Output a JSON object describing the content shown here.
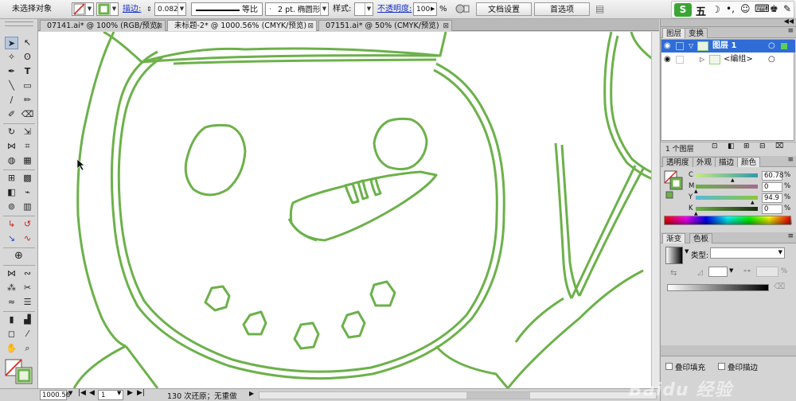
{
  "control_bar": {
    "selection_status": "未选择对象",
    "stroke_label": "描边:",
    "stroke_width": "0.082",
    "profile_label": "等比",
    "brush_label": "2 pt. 椭圆形",
    "style_label": "样式:",
    "opacity_label": "不透明度:",
    "opacity_value": "100",
    "opacity_unit": "%",
    "document_setup_button": "文档设置",
    "preferences_button": "首选项",
    "fill_color": "#ffffff",
    "stroke_color": "#6cb14a"
  },
  "ime_toolbar": {
    "logo": "S",
    "mode": "五"
  },
  "document_tabs": [
    {
      "label": "07141.ai* @ 100% (RGB/预览)",
      "close": "⊠"
    },
    {
      "label": "未标题-2* @ 1000.56% (CMYK/预览)",
      "close": "⊠"
    },
    {
      "label": "07151.ai* @ 50% (CMYK/预览)",
      "close": "⊠"
    }
  ],
  "status_bar": {
    "zoom": "1000.56",
    "page": "1",
    "history": "130 次还原；无重做"
  },
  "layers_panel": {
    "tabs": [
      "图层",
      "变换"
    ],
    "layer_name": "图层 1",
    "group_name": "<编组>",
    "layer_count": "1 个图层"
  },
  "color_panel": {
    "tabs": [
      "透明度",
      "外观",
      "描边",
      "颜色"
    ],
    "channels": [
      {
        "label": "C",
        "value": "60.78"
      },
      {
        "label": "M",
        "value": "0"
      },
      {
        "label": "Y",
        "value": "94.9"
      },
      {
        "label": "K",
        "value": "0"
      }
    ],
    "unit": "%",
    "stroke_swatch_color": "#6cb14a"
  },
  "gradient_panel": {
    "tabs": [
      "渐变",
      "色板"
    ],
    "type_label": "类型:",
    "type_value": "",
    "percent_unit": "%"
  },
  "attributes_panel": {
    "overprint_fill": "叠印填充",
    "overprint_stroke": "叠印描边"
  },
  "watermark": "Baidu 经验",
  "colors": {
    "stroke_green": "#6cb14a",
    "accent_blue": "#1a33c8",
    "layer_highlight": "#2f6cd6"
  }
}
